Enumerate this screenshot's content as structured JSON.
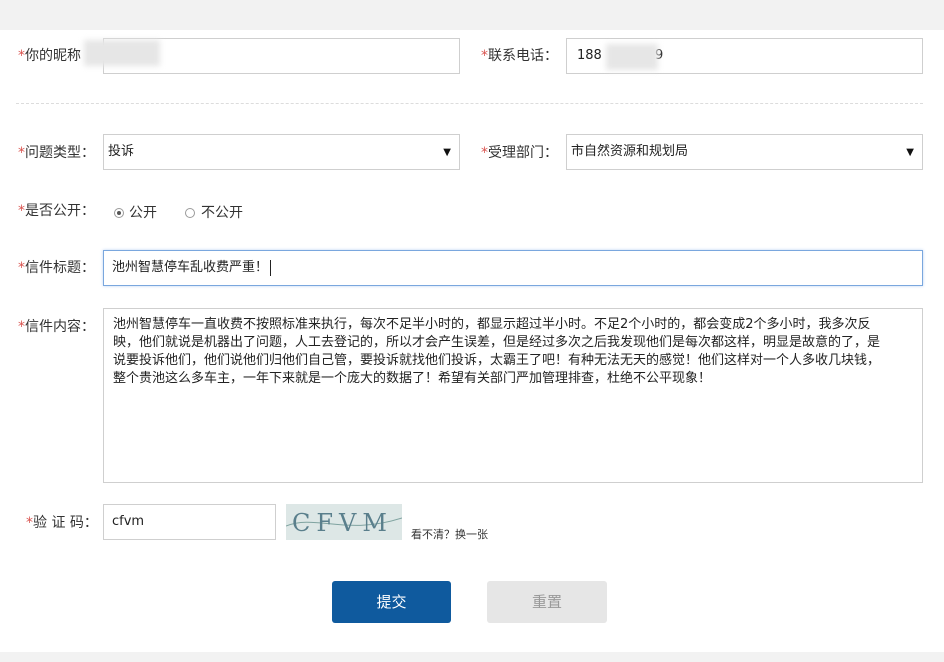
{
  "form": {
    "nickname": {
      "required_mark": "*",
      "label": "你的昵称",
      "value": ""
    },
    "phone": {
      "required_mark": "*",
      "label": "联系电话：",
      "value_prefix": "188",
      "value_suffix": "9"
    },
    "issue_type": {
      "required_mark": "*",
      "label": "问题类型：",
      "selected": "投诉"
    },
    "department": {
      "required_mark": "*",
      "label": "受理部门：",
      "selected": "市自然资源和规划局"
    },
    "is_public": {
      "required_mark": "*",
      "label": "是否公开：",
      "options": [
        "公开",
        "不公开"
      ],
      "selected": "公开"
    },
    "title": {
      "required_mark": "*",
      "label": "信件标题：",
      "value": "池州智慧停车乱收费严重！"
    },
    "content": {
      "required_mark": "*",
      "label": "信件内容：",
      "lines": [
        "池州智慧停车一直收费不按照标准来执行，每次不足半小时的，都显示超过半小时。不足2个小时的，都会变成2个多小时，我多次反",
        "映，他们就说是机器出了问题，人工去登记的，所以才会产生误差，但是经过多次之后我发现他们是每次都这样，明显是故意的了，是",
        "说要投诉他们，他们说他们归他们自己管，要投诉就找他们投诉，太霸王了吧！有种无法无天的感觉！他们这样对一个人多收几块钱，",
        "整个贵池这么多车主，一年下来就是一个庞大的数据了！希望有关部门严加管理排查，杜绝不公平现象！"
      ]
    },
    "captcha": {
      "required_mark": "*",
      "label": "验 证 码：",
      "value": "cfvm",
      "image_text": "CFVM",
      "refresh_link": "看不清？换一张"
    },
    "buttons": {
      "submit": "提交",
      "reset": "重置"
    }
  },
  "colors": {
    "required": "#d9534f",
    "submit_bg": "#0f5a9e",
    "reset_bg": "#e6e6e6",
    "focus_border": "#7aa7de"
  },
  "icons": {
    "select_arrow": "▼"
  }
}
